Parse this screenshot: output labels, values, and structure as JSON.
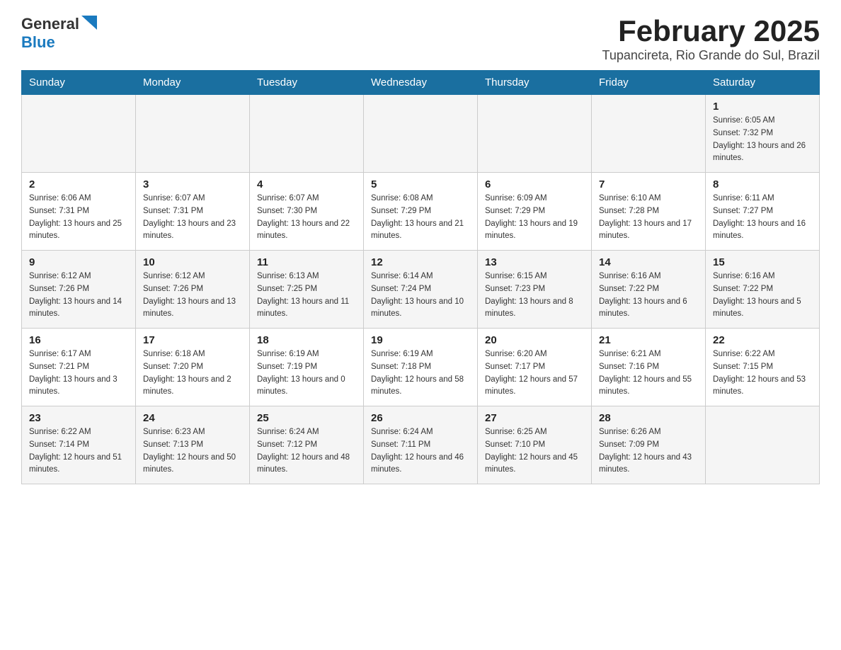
{
  "header": {
    "logo_general": "General",
    "logo_blue": "Blue",
    "month_title": "February 2025",
    "location": "Tupancireta, Rio Grande do Sul, Brazil"
  },
  "weekdays": [
    "Sunday",
    "Monday",
    "Tuesday",
    "Wednesday",
    "Thursday",
    "Friday",
    "Saturday"
  ],
  "weeks": [
    [
      {
        "day": "",
        "info": ""
      },
      {
        "day": "",
        "info": ""
      },
      {
        "day": "",
        "info": ""
      },
      {
        "day": "",
        "info": ""
      },
      {
        "day": "",
        "info": ""
      },
      {
        "day": "",
        "info": ""
      },
      {
        "day": "1",
        "info": "Sunrise: 6:05 AM\nSunset: 7:32 PM\nDaylight: 13 hours and 26 minutes."
      }
    ],
    [
      {
        "day": "2",
        "info": "Sunrise: 6:06 AM\nSunset: 7:31 PM\nDaylight: 13 hours and 25 minutes."
      },
      {
        "day": "3",
        "info": "Sunrise: 6:07 AM\nSunset: 7:31 PM\nDaylight: 13 hours and 23 minutes."
      },
      {
        "day": "4",
        "info": "Sunrise: 6:07 AM\nSunset: 7:30 PM\nDaylight: 13 hours and 22 minutes."
      },
      {
        "day": "5",
        "info": "Sunrise: 6:08 AM\nSunset: 7:29 PM\nDaylight: 13 hours and 21 minutes."
      },
      {
        "day": "6",
        "info": "Sunrise: 6:09 AM\nSunset: 7:29 PM\nDaylight: 13 hours and 19 minutes."
      },
      {
        "day": "7",
        "info": "Sunrise: 6:10 AM\nSunset: 7:28 PM\nDaylight: 13 hours and 17 minutes."
      },
      {
        "day": "8",
        "info": "Sunrise: 6:11 AM\nSunset: 7:27 PM\nDaylight: 13 hours and 16 minutes."
      }
    ],
    [
      {
        "day": "9",
        "info": "Sunrise: 6:12 AM\nSunset: 7:26 PM\nDaylight: 13 hours and 14 minutes."
      },
      {
        "day": "10",
        "info": "Sunrise: 6:12 AM\nSunset: 7:26 PM\nDaylight: 13 hours and 13 minutes."
      },
      {
        "day": "11",
        "info": "Sunrise: 6:13 AM\nSunset: 7:25 PM\nDaylight: 13 hours and 11 minutes."
      },
      {
        "day": "12",
        "info": "Sunrise: 6:14 AM\nSunset: 7:24 PM\nDaylight: 13 hours and 10 minutes."
      },
      {
        "day": "13",
        "info": "Sunrise: 6:15 AM\nSunset: 7:23 PM\nDaylight: 13 hours and 8 minutes."
      },
      {
        "day": "14",
        "info": "Sunrise: 6:16 AM\nSunset: 7:22 PM\nDaylight: 13 hours and 6 minutes."
      },
      {
        "day": "15",
        "info": "Sunrise: 6:16 AM\nSunset: 7:22 PM\nDaylight: 13 hours and 5 minutes."
      }
    ],
    [
      {
        "day": "16",
        "info": "Sunrise: 6:17 AM\nSunset: 7:21 PM\nDaylight: 13 hours and 3 minutes."
      },
      {
        "day": "17",
        "info": "Sunrise: 6:18 AM\nSunset: 7:20 PM\nDaylight: 13 hours and 2 minutes."
      },
      {
        "day": "18",
        "info": "Sunrise: 6:19 AM\nSunset: 7:19 PM\nDaylight: 13 hours and 0 minutes."
      },
      {
        "day": "19",
        "info": "Sunrise: 6:19 AM\nSunset: 7:18 PM\nDaylight: 12 hours and 58 minutes."
      },
      {
        "day": "20",
        "info": "Sunrise: 6:20 AM\nSunset: 7:17 PM\nDaylight: 12 hours and 57 minutes."
      },
      {
        "day": "21",
        "info": "Sunrise: 6:21 AM\nSunset: 7:16 PM\nDaylight: 12 hours and 55 minutes."
      },
      {
        "day": "22",
        "info": "Sunrise: 6:22 AM\nSunset: 7:15 PM\nDaylight: 12 hours and 53 minutes."
      }
    ],
    [
      {
        "day": "23",
        "info": "Sunrise: 6:22 AM\nSunset: 7:14 PM\nDaylight: 12 hours and 51 minutes."
      },
      {
        "day": "24",
        "info": "Sunrise: 6:23 AM\nSunset: 7:13 PM\nDaylight: 12 hours and 50 minutes."
      },
      {
        "day": "25",
        "info": "Sunrise: 6:24 AM\nSunset: 7:12 PM\nDaylight: 12 hours and 48 minutes."
      },
      {
        "day": "26",
        "info": "Sunrise: 6:24 AM\nSunset: 7:11 PM\nDaylight: 12 hours and 46 minutes."
      },
      {
        "day": "27",
        "info": "Sunrise: 6:25 AM\nSunset: 7:10 PM\nDaylight: 12 hours and 45 minutes."
      },
      {
        "day": "28",
        "info": "Sunrise: 6:26 AM\nSunset: 7:09 PM\nDaylight: 12 hours and 43 minutes."
      },
      {
        "day": "",
        "info": ""
      }
    ]
  ]
}
